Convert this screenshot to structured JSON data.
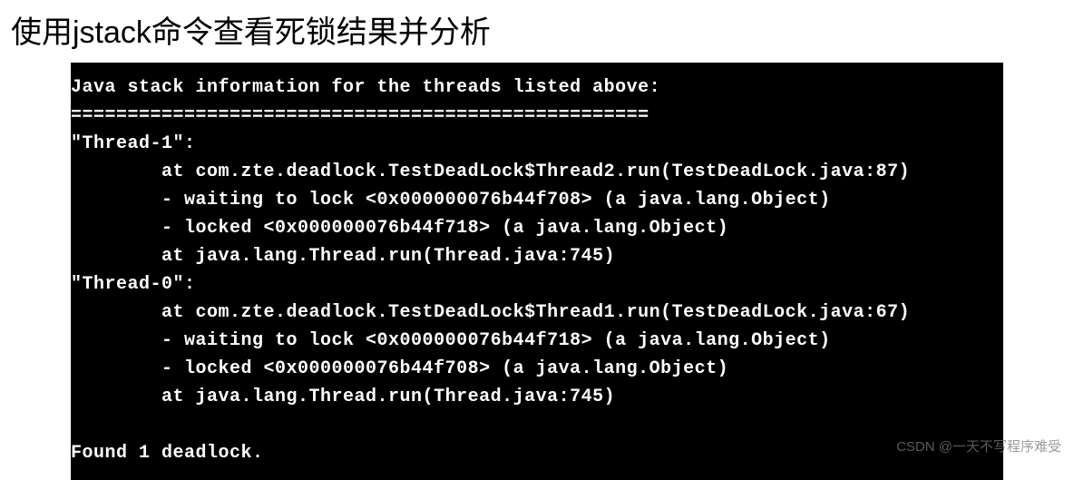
{
  "heading": "使用jstack命令查看死锁结果并分析",
  "terminal": {
    "lines": [
      "Java stack information for the threads listed above:",
      "===================================================",
      "\"Thread-1\":",
      "        at com.zte.deadlock.TestDeadLock$Thread2.run(TestDeadLock.java:87)",
      "        - waiting to lock <0x000000076b44f708> (a java.lang.Object)",
      "        - locked <0x000000076b44f718> (a java.lang.Object)",
      "        at java.lang.Thread.run(Thread.java:745)",
      "\"Thread-0\":",
      "        at com.zte.deadlock.TestDeadLock$Thread1.run(TestDeadLock.java:67)",
      "        - waiting to lock <0x000000076b44f718> (a java.lang.Object)",
      "        - locked <0x000000076b44f708> (a java.lang.Object)",
      "        at java.lang.Thread.run(Thread.java:745)",
      "",
      "Found 1 deadlock."
    ]
  },
  "watermark": "CSDN @一天不写程序难受"
}
